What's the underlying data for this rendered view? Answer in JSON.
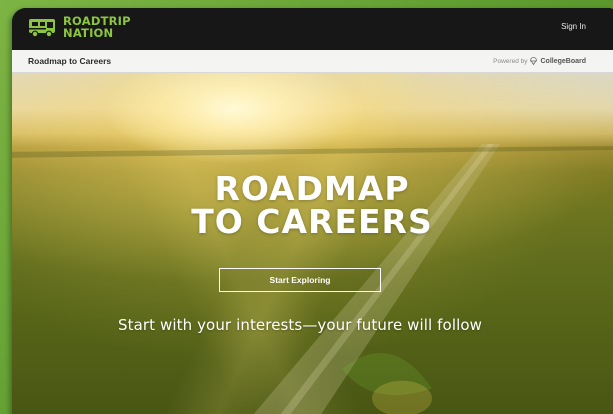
{
  "brand": {
    "line1": "ROADTRIP",
    "line2": "NATION",
    "accent": "#8cc63f",
    "icon": "rv-camper-icon"
  },
  "header": {
    "signin_label": "Sign In"
  },
  "subheader": {
    "title": "Roadmap to Careers",
    "powered_by": "Powered by",
    "partner": "CollegeBoard",
    "partner_icon": "collegeboard-acorn-icon"
  },
  "hero": {
    "title_line1": "ROADMAP",
    "title_line2": "TO CAREERS",
    "cta_label": "Start Exploring",
    "tagline": "Start with your interests—your future will follow"
  },
  "colors": {
    "background_green": "#6aa83a",
    "topbar": "#171717",
    "subbar": "#f4f4f2",
    "text_light": "#ffffff"
  }
}
